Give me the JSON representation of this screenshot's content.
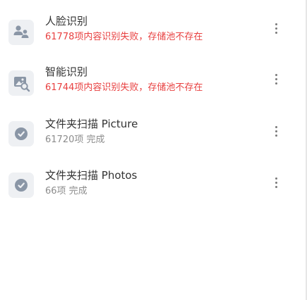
{
  "tasks": [
    {
      "title": "人脸识别",
      "status": "61778项内容识别失败，存储池不存在",
      "status_type": "error",
      "icon": "face-recognition-icon"
    },
    {
      "title": "智能识别",
      "status": "61744项内容识别失败，存储池不存在",
      "status_type": "error",
      "icon": "smart-recognition-icon"
    },
    {
      "title": "文件夹扫描 Picture",
      "status": "61720项 完成",
      "status_type": "normal",
      "icon": "folder-scan-icon"
    },
    {
      "title": "文件夹扫描 Photos",
      "status": "66项 完成",
      "status_type": "normal",
      "icon": "folder-scan-icon"
    }
  ],
  "colors": {
    "error": "#e84040",
    "muted": "#8c8c8c",
    "icon": "#8a96a6",
    "icon_bg": "#eef0f3"
  }
}
